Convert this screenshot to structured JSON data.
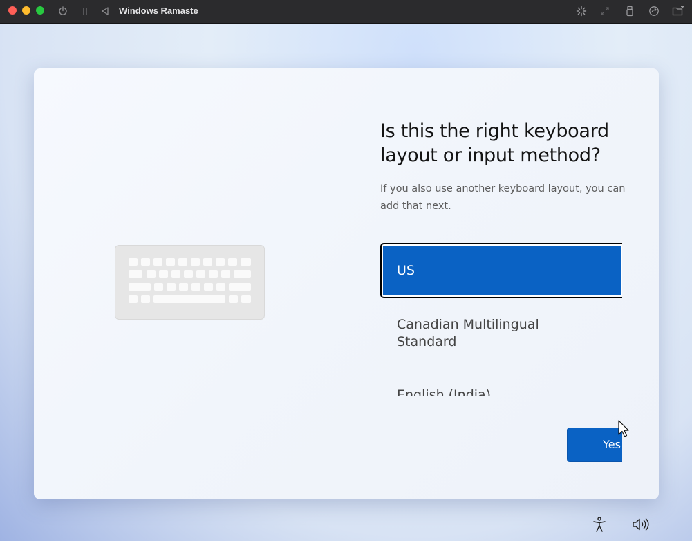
{
  "window": {
    "title": "Windows Ramaste",
    "controls": [
      "close-icon",
      "minimize-icon",
      "zoom-icon"
    ],
    "toolbar_icons": [
      "power-icon",
      "pause-icon",
      "back-icon",
      "loading-icon",
      "fullscreen-icon",
      "usb-icon",
      "share-icon",
      "folder-icon"
    ],
    "colors": {
      "close": "#ff5f57",
      "minimize": "#febc2e",
      "zoom": "#28c840",
      "titlebar": "#2b2b2d"
    }
  },
  "setup": {
    "heading": "Is this the right keyboard layout or input method?",
    "subtext": "If you also use another keyboard layout, you can add that next.",
    "illustration": "keyboard-icon",
    "layouts": [
      {
        "label": "US",
        "selected": true
      },
      {
        "label": "Canadian Multilingual Standard",
        "selected": false
      },
      {
        "label": "English (India)",
        "selected": false
      }
    ],
    "yes_button": "Yes",
    "accent": "#0a62c4"
  },
  "taskbar": {
    "icons": [
      "accessibility-icon",
      "volume-icon"
    ]
  }
}
